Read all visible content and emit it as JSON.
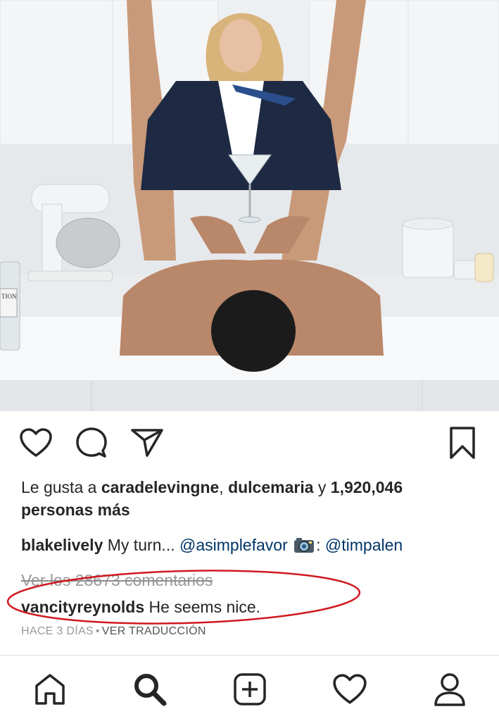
{
  "post": {
    "image_description_icon": "post-photo",
    "bottle_label": "TION"
  },
  "actions": {
    "like_icon": "heart-outline-icon",
    "comment_icon": "speech-bubble-icon",
    "share_icon": "paper-plane-icon",
    "save_icon": "bookmark-icon"
  },
  "likes": {
    "prefix": "Le gusta a ",
    "user1": "caradelevingne",
    "sep": ", ",
    "user2": "dulcemaria",
    "conj": " y ",
    "count": "1,920,046",
    "suffix": "personas más"
  },
  "caption": {
    "username": "blakelively",
    "text": " My turn... ",
    "mention1": "@asimplefavor",
    "camera_icon": "camera-emoji-icon",
    "colon": ": ",
    "mention2": "@timpalen"
  },
  "comments": {
    "view_all": "Ver los 28673 comentarios",
    "top_comment": {
      "username": "vancityreynolds",
      "text": " He seems nice."
    },
    "annotation_color": "#d0181f"
  },
  "meta": {
    "time": "HACE 3 DÍAS",
    "dot": "•",
    "translate": "VER TRADUCCIÓN"
  },
  "nav": {
    "home_icon": "home-icon",
    "search_icon": "search-icon",
    "add_icon": "add-post-icon",
    "activity_icon": "heart-icon",
    "profile_icon": "profile-icon"
  }
}
